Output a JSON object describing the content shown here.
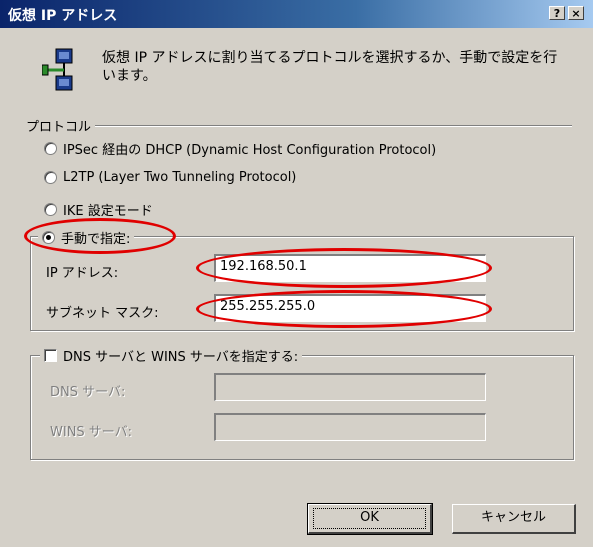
{
  "window": {
    "title": "仮想 IP アドレス",
    "help_glyph": "?",
    "close_glyph": "×"
  },
  "icons": {
    "title_help": "help-icon",
    "title_close": "close-icon",
    "network": "network-adapter-icon"
  },
  "description": "仮想 IP アドレスに割り当てるプロトコルを選択するか、手動で設定を行います。",
  "protocol_group": {
    "label": "プロトコル",
    "options": [
      {
        "label": "IPSec 経由の DHCP (Dynamic Host Configuration Protocol)",
        "selected": false
      },
      {
        "label": "L2TP (Layer Two Tunneling Protocol)",
        "selected": false
      },
      {
        "label": "IKE 設定モード",
        "selected": false
      },
      {
        "label": "手動で指定:",
        "selected": true
      }
    ]
  },
  "manual": {
    "ip_label": "IP アドレス:",
    "ip_value": "192.168.50.1",
    "mask_label": "サブネット マスク:",
    "mask_value": "255.255.255.0"
  },
  "dns_group": {
    "checkbox_label": "DNS サーバと WINS サーバを指定する:",
    "checked": false,
    "dns_label": "DNS サーバ:",
    "dns_value": "",
    "wins_label": "WINS サーバ:",
    "wins_value": ""
  },
  "buttons": {
    "ok": "OK",
    "cancel": "キャンセル"
  },
  "colors": {
    "annotation": "#e00000",
    "title_bar": "#0a246a",
    "dialog_face": "#d4d0c8"
  }
}
